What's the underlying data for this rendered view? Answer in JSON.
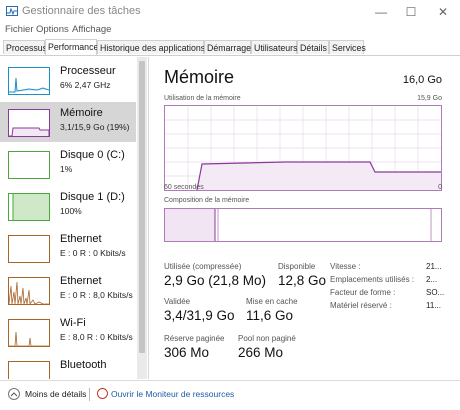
{
  "window": {
    "title": "Gestionnaire des tâches"
  },
  "menu": [
    "Fichier",
    "Options",
    "Affichage"
  ],
  "tabs": [
    "Processus",
    "Performance",
    "Historique des applications",
    "Démarrage",
    "Utilisateurs",
    "Détails",
    "Services"
  ],
  "active_tab": "Performance",
  "sidebar": [
    {
      "name": "Processeur",
      "sub": "6% 2,47 GHz",
      "color": "#1a8fc9"
    },
    {
      "name": "Mémoire",
      "sub": "3,1/15,9 Go (19%)",
      "color": "#8b3a9a"
    },
    {
      "name": "Disque 0 (C:)",
      "sub": "1%",
      "color": "#4aa83a"
    },
    {
      "name": "Disque 1 (D:)",
      "sub": "100%",
      "color": "#4aa83a"
    },
    {
      "name": "Ethernet",
      "sub": "E : 0 R : 0 Kbits/s",
      "color": "#a8652a"
    },
    {
      "name": "Ethernet",
      "sub": "E : 0 R : 8,0 Kbits/s",
      "color": "#a8652a"
    },
    {
      "name": "Wi-Fi",
      "sub": "E : 8,0 R : 0 Kbits/s",
      "color": "#a8652a"
    },
    {
      "name": "Bluetooth",
      "sub": "",
      "color": "#a8652a"
    }
  ],
  "main": {
    "title": "Mémoire",
    "total": "16,0 Go",
    "graph_label": "Utilisation de la mémoire",
    "graph_max": "15,9 Go",
    "time_left": "60 secondes",
    "time_right": "0",
    "composition_label": "Composition de la mémoire",
    "accent": "#8b3a9a"
  },
  "stats": {
    "in_use_label": "Utilisée (compressée)",
    "in_use_value": "2,9 Go (21,8 Mo)",
    "available_label": "Disponible",
    "available_value": "12,8 Go",
    "committed_label": "Validée",
    "committed_value": "3,4/31,9 Go",
    "cached_label": "Mise en cache",
    "cached_value": "11,6 Go",
    "paged_label": "Réserve paginée",
    "paged_value": "306 Mo",
    "nonpaged_label": "Pool non paginé",
    "nonpaged_value": "266 Mo"
  },
  "right": [
    {
      "label": "Vitesse :",
      "value": "21..."
    },
    {
      "label": "Emplacements utilisés :",
      "value": "2..."
    },
    {
      "label": "Facteur de forme :",
      "value": "SO..."
    },
    {
      "label": "Matériel réservé :",
      "value": "11..."
    }
  ],
  "footer": {
    "less_details": "Moins de détails",
    "open_monitor": "Ouvrir le Moniteur de ressources"
  }
}
